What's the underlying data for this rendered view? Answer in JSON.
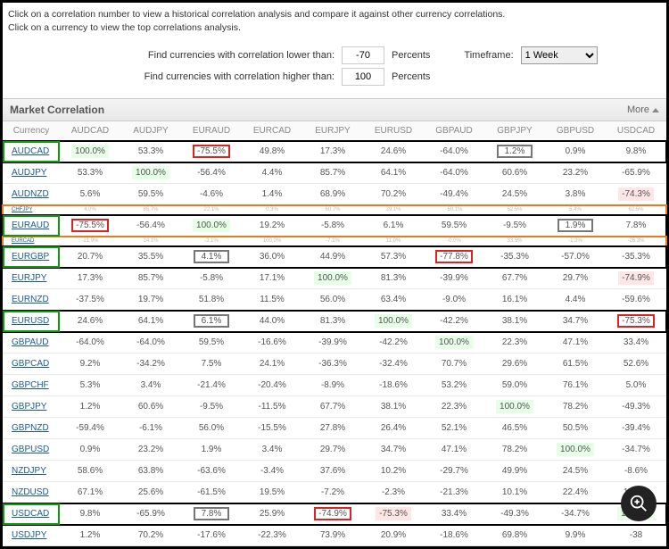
{
  "instructions": {
    "line1": "Click on a correlation number to view a historical correlation analysis and compare it against other currency correlations.",
    "line2": "Click on a currency to view the top correlations analysis."
  },
  "filters": {
    "lower_label": "Find currencies with correlation lower than:",
    "lower_value": "-70",
    "higher_label": "Find currencies with correlation higher than:",
    "higher_value": "100",
    "percents": "Percents",
    "timeframe_label": "Timeframe:",
    "timeframe_value": "1 Week"
  },
  "section": {
    "title": "Market Correlation",
    "more": "More"
  },
  "chart_data": {
    "type": "table",
    "currency_header": "Currency",
    "columns": [
      "AUDCAD",
      "AUDJPY",
      "EURAUD",
      "EURCAD",
      "EURJPY",
      "EURUSD",
      "GBPAUD",
      "GBPJPY",
      "GBPUSD",
      "USDCAD"
    ],
    "rows": [
      {
        "cur": "AUDCAD",
        "hl": "black",
        "cur_box": "green",
        "v": [
          {
            "t": "100.0%",
            "bg": "pos"
          },
          {
            "t": "53.3%"
          },
          {
            "t": "-75.5%",
            "box": "red"
          },
          {
            "t": "49.8%"
          },
          {
            "t": "17.3%"
          },
          {
            "t": "24.6%"
          },
          {
            "t": "-64.0%"
          },
          {
            "t": "1.2%",
            "box": "grey"
          },
          {
            "t": "0.9%"
          },
          {
            "t": "9.8%"
          }
        ]
      },
      {
        "cur": "AUDJPY",
        "v": [
          {
            "t": "53.3%"
          },
          {
            "t": "100.0%",
            "bg": "pos"
          },
          {
            "t": "-56.4%"
          },
          {
            "t": "4.4%"
          },
          {
            "t": "85.7%"
          },
          {
            "t": "64.1%"
          },
          {
            "t": "-64.0%"
          },
          {
            "t": "60.6%"
          },
          {
            "t": "23.2%"
          },
          {
            "t": "-65.9%"
          }
        ]
      },
      {
        "cur": "AUDNZD",
        "v": [
          {
            "t": "5.6%"
          },
          {
            "t": "59.5%"
          },
          {
            "t": "-4.6%"
          },
          {
            "t": "1.4%"
          },
          {
            "t": "68.9%"
          },
          {
            "t": "70.2%"
          },
          {
            "t": "-49.4%"
          },
          {
            "t": "24.5%"
          },
          {
            "t": "3.8%"
          },
          {
            "t": "-74.3%",
            "bg": "neg"
          }
        ]
      },
      {
        "cur": "CHFJPY",
        "mini": true,
        "hl": "orange",
        "v": [
          {
            "t": "4.0%"
          },
          {
            "t": "85.7%"
          },
          {
            "t": "22.1%"
          },
          {
            "t": "0.3%"
          },
          {
            "t": "60.7%"
          },
          {
            "t": "39.1%"
          },
          {
            "t": "-50.1%"
          },
          {
            "t": "52.5%"
          },
          {
            "t": "5.4%"
          },
          {
            "t": "62.5%"
          }
        ]
      },
      {
        "cur": "EURAUD",
        "hl": "black",
        "cur_box": "green",
        "v": [
          {
            "t": "-75.5%",
            "box": "red"
          },
          {
            "t": "-56.4%"
          },
          {
            "t": "100.0%",
            "bg": "pos"
          },
          {
            "t": "19.2%"
          },
          {
            "t": "-5.8%"
          },
          {
            "t": "6.1%"
          },
          {
            "t": "59.5%"
          },
          {
            "t": "-9.5%"
          },
          {
            "t": "1.9%",
            "box": "grey"
          },
          {
            "t": "7.8%"
          }
        ]
      },
      {
        "cur": "EURCAD",
        "mini": true,
        "hl": "orange",
        "v": [
          {
            "t": "-21.9%"
          },
          {
            "t": "14.1%"
          },
          {
            "t": "-3.1%"
          },
          {
            "t": "100.0%"
          },
          {
            "t": "-7.1%"
          },
          {
            "t": "11.0%"
          },
          {
            "t": "-0.0%"
          },
          {
            "t": "33.5%"
          },
          {
            "t": "-1.3%"
          },
          {
            "t": "-26.3%"
          }
        ]
      },
      {
        "cur": "EURGBP",
        "hl": "black",
        "cur_box": "green",
        "v": [
          {
            "t": "20.7%"
          },
          {
            "t": "35.5%"
          },
          {
            "t": "4.1%",
            "box": "grey"
          },
          {
            "t": "36.0%"
          },
          {
            "t": "44.9%"
          },
          {
            "t": "57.3%"
          },
          {
            "t": "-77.8%",
            "box": "red"
          },
          {
            "t": "-35.3%"
          },
          {
            "t": "-57.0%"
          },
          {
            "t": "-35.3%"
          }
        ]
      },
      {
        "cur": "EURJPY",
        "v": [
          {
            "t": "17.3%"
          },
          {
            "t": "85.7%"
          },
          {
            "t": "-5.8%"
          },
          {
            "t": "17.1%"
          },
          {
            "t": "100.0%",
            "bg": "pos"
          },
          {
            "t": "81.3%"
          },
          {
            "t": "-39.9%"
          },
          {
            "t": "67.7%"
          },
          {
            "t": "29.7%"
          },
          {
            "t": "-74.9%",
            "bg": "neg"
          }
        ]
      },
      {
        "cur": "EURNZD",
        "v": [
          {
            "t": "-37.5%"
          },
          {
            "t": "19.7%"
          },
          {
            "t": "51.8%"
          },
          {
            "t": "11.5%"
          },
          {
            "t": "56.0%"
          },
          {
            "t": "63.4%"
          },
          {
            "t": "-9.0%"
          },
          {
            "t": "16.1%"
          },
          {
            "t": "4.4%"
          },
          {
            "t": "-59.6%"
          }
        ]
      },
      {
        "cur": "EURUSD",
        "hl": "black",
        "cur_box": "green",
        "v": [
          {
            "t": "24.6%"
          },
          {
            "t": "64.1%"
          },
          {
            "t": "6.1%",
            "box": "grey"
          },
          {
            "t": "44.0%"
          },
          {
            "t": "81.3%"
          },
          {
            "t": "100.0%",
            "bg": "pos"
          },
          {
            "t": "-42.2%"
          },
          {
            "t": "38.1%"
          },
          {
            "t": "34.7%"
          },
          {
            "t": "-75.3%",
            "box": "red"
          }
        ]
      },
      {
        "cur": "GBPAUD",
        "v": [
          {
            "t": "-64.0%"
          },
          {
            "t": "-64.0%"
          },
          {
            "t": "59.5%"
          },
          {
            "t": "-16.6%"
          },
          {
            "t": "-39.9%"
          },
          {
            "t": "-42.2%"
          },
          {
            "t": "100.0%",
            "bg": "pos"
          },
          {
            "t": "22.3%"
          },
          {
            "t": "47.1%"
          },
          {
            "t": "33.4%"
          }
        ]
      },
      {
        "cur": "GBPCAD",
        "v": [
          {
            "t": "9.2%"
          },
          {
            "t": "-34.2%"
          },
          {
            "t": "7.5%"
          },
          {
            "t": "24.1%"
          },
          {
            "t": "-36.3%"
          },
          {
            "t": "-32.4%"
          },
          {
            "t": "70.7%"
          },
          {
            "t": "29.6%"
          },
          {
            "t": "61.5%"
          },
          {
            "t": "52.6%"
          }
        ]
      },
      {
        "cur": "GBPCHF",
        "v": [
          {
            "t": "5.3%"
          },
          {
            "t": "3.4%"
          },
          {
            "t": "-21.4%"
          },
          {
            "t": "-20.4%"
          },
          {
            "t": "-8.9%"
          },
          {
            "t": "-18.6%"
          },
          {
            "t": "53.2%"
          },
          {
            "t": "59.0%"
          },
          {
            "t": "76.1%"
          },
          {
            "t": "5.0%"
          }
        ]
      },
      {
        "cur": "GBPJPY",
        "v": [
          {
            "t": "1.2%"
          },
          {
            "t": "60.6%"
          },
          {
            "t": "-9.5%"
          },
          {
            "t": "-11.5%"
          },
          {
            "t": "67.7%"
          },
          {
            "t": "38.1%"
          },
          {
            "t": "22.3%"
          },
          {
            "t": "100.0%",
            "bg": "pos"
          },
          {
            "t": "78.2%"
          },
          {
            "t": "-49.3%"
          }
        ]
      },
      {
        "cur": "GBPNZD",
        "v": [
          {
            "t": "-59.4%"
          },
          {
            "t": "-6.1%"
          },
          {
            "t": "56.0%"
          },
          {
            "t": "-15.5%"
          },
          {
            "t": "27.8%"
          },
          {
            "t": "26.4%"
          },
          {
            "t": "52.1%"
          },
          {
            "t": "46.5%"
          },
          {
            "t": "50.5%"
          },
          {
            "t": "-39.4%"
          }
        ]
      },
      {
        "cur": "GBPUSD",
        "v": [
          {
            "t": "0.9%"
          },
          {
            "t": "23.2%"
          },
          {
            "t": "1.9%"
          },
          {
            "t": "3.4%"
          },
          {
            "t": "29.7%"
          },
          {
            "t": "34.7%"
          },
          {
            "t": "47.1%"
          },
          {
            "t": "78.2%"
          },
          {
            "t": "100.0%",
            "bg": "pos"
          },
          {
            "t": "-34.7%"
          }
        ]
      },
      {
        "cur": "NZDJPY",
        "v": [
          {
            "t": "58.6%"
          },
          {
            "t": "63.8%"
          },
          {
            "t": "-63.6%"
          },
          {
            "t": "-3.4%"
          },
          {
            "t": "37.6%"
          },
          {
            "t": "10.2%"
          },
          {
            "t": "-29.7%"
          },
          {
            "t": "49.9%"
          },
          {
            "t": "24.5%"
          },
          {
            "t": "-8.6%"
          }
        ]
      },
      {
        "cur": "NZDUSD",
        "v": [
          {
            "t": "67.1%"
          },
          {
            "t": "25.6%"
          },
          {
            "t": "-61.5%"
          },
          {
            "t": "19.5%"
          },
          {
            "t": "-7.2%"
          },
          {
            "t": "-2.3%"
          },
          {
            "t": "-21.3%"
          },
          {
            "t": "10.1%"
          },
          {
            "t": "22.4%"
          },
          {
            "t": "16.4%"
          }
        ]
      },
      {
        "cur": "USDCAD",
        "hl": "black",
        "cur_box": "green",
        "v": [
          {
            "t": "9.8%"
          },
          {
            "t": "-65.9%"
          },
          {
            "t": "7.8%",
            "box": "grey"
          },
          {
            "t": "25.9%"
          },
          {
            "t": "-74.9%",
            "box": "red"
          },
          {
            "t": "-75.3%",
            "bg": "neg"
          },
          {
            "t": "33.4%"
          },
          {
            "t": "-49.3%"
          },
          {
            "t": "-34.7%"
          },
          {
            "t": "100.0%",
            "bg": "pos"
          }
        ]
      },
      {
        "cur": "USDJPY",
        "v": [
          {
            "t": "1.2%"
          },
          {
            "t": "70.2%"
          },
          {
            "t": "-17.6%"
          },
          {
            "t": "-22.3%"
          },
          {
            "t": "73.9%"
          },
          {
            "t": "20.9%"
          },
          {
            "t": "-18.6%"
          },
          {
            "t": "69.8%"
          },
          {
            "t": "9.9%"
          },
          {
            "t": "-38"
          }
        ]
      }
    ]
  }
}
